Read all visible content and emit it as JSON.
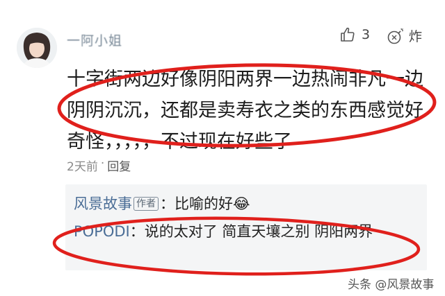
{
  "user": {
    "name": "一阿小姐"
  },
  "actions": {
    "like_count": "3",
    "bomb_label": "炸"
  },
  "comment": {
    "text": "十字街两边好像阴阳两界一边热闹非凡一边阴阴沉沉，还都是卖寿衣之类的东西感觉好奇怪，，，，，不过现在好些了"
  },
  "meta": {
    "time": "2天前",
    "separator": "·",
    "reply_label": "回复"
  },
  "replies": [
    {
      "author": "风景故事",
      "tag": "作者",
      "separator": "：",
      "text": "比喻的好😂"
    },
    {
      "author": "POPODI",
      "separator": "：",
      "text": "说的太对了 简直天壤之别 阴阳两界"
    }
  ],
  "watermark": "头条 @风景故事",
  "colors": {
    "annotation_ellipse": "#e0201c",
    "reply_author": "#4a6d96",
    "reply_bg": "#f4f5f6"
  }
}
